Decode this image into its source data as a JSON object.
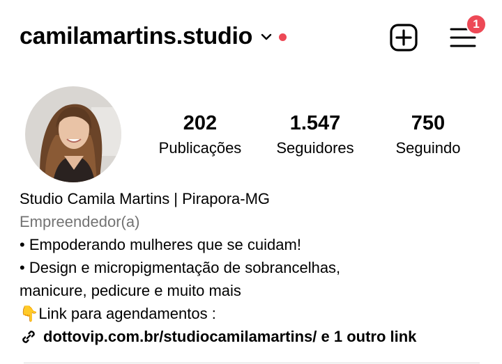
{
  "header": {
    "username": "camilamartins.studio",
    "notification_badge": "1",
    "colors": {
      "accent_red": "#ed4956"
    },
    "icons": {
      "dropdown": "chevron-down-icon",
      "add": "plus-square-icon",
      "menu": "hamburger-menu-icon"
    }
  },
  "profile": {
    "avatar_icon": "profile-photo",
    "stats": [
      {
        "value": "202",
        "label": "Publicações"
      },
      {
        "value": "1.547",
        "label": "Seguidores"
      },
      {
        "value": "750",
        "label": "Seguindo"
      }
    ]
  },
  "bio": {
    "name": "Studio Camila Martins | Pirapora-MG",
    "category": "Empreendedor(a)",
    "line1": "• Empoderando mulheres que se cuidam!",
    "line2": "• Design e micropigmentação de sobrancelhas,",
    "line3": "manicure, pedicure e muito mais",
    "line4_emoji": "👇",
    "line4": "Link para agendamentos :",
    "link": "dottovip.com.br/studiocamilamartins/ e 1 outro link",
    "link_icon": "link-icon"
  }
}
